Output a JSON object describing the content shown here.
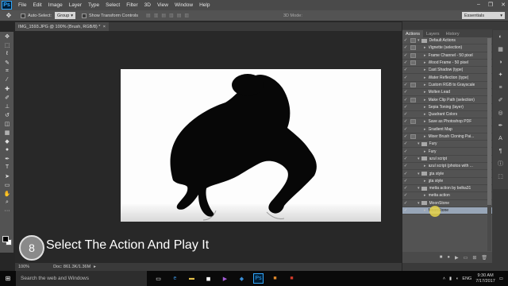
{
  "menubar": {
    "logo": "Ps",
    "items": [
      "File",
      "Edit",
      "Image",
      "Layer",
      "Type",
      "Select",
      "Filter",
      "3D",
      "View",
      "Window",
      "Help"
    ],
    "window_controls": [
      "–",
      "❐",
      "✕"
    ]
  },
  "options": {
    "auto_select_label": "Auto-Select:",
    "auto_select_value": "Group",
    "transform_label": "Show Transform Controls",
    "mode_3d_label": "3D Mode:",
    "workspace": "Essentials"
  },
  "document": {
    "tab_title": "IMG_1593.JPG @ 100% (Brush, RGB/8) *",
    "zoom": "100%",
    "doc_info": "Doc: 861.3K/1.36M"
  },
  "panel_tabs": [
    "Actions",
    "Layers",
    "History"
  ],
  "actions": [
    {
      "label": "Default Actions",
      "kind": "set",
      "dialog": true
    },
    {
      "label": "Vignette (selection)",
      "kind": "action",
      "dialog": true
    },
    {
      "label": "Frame Channel - 50 pixel",
      "kind": "action",
      "dialog": true
    },
    {
      "label": "Wood Frame - 50 pixel",
      "kind": "action",
      "dialog": true
    },
    {
      "label": "Cast Shadow (type)",
      "kind": "action",
      "dialog": false
    },
    {
      "label": "Water Reflection (type)",
      "kind": "action",
      "dialog": false
    },
    {
      "label": "Custom RGB to Grayscale",
      "kind": "action",
      "dialog": true
    },
    {
      "label": "Molten Lead",
      "kind": "action",
      "dialog": false
    },
    {
      "label": "Make Clip Path (selection)",
      "kind": "action",
      "dialog": true
    },
    {
      "label": "Sepia Toning (layer)",
      "kind": "action",
      "dialog": false
    },
    {
      "label": "Quadrant Colors",
      "kind": "action",
      "dialog": false
    },
    {
      "label": "Save as Photoshop PDF",
      "kind": "action",
      "dialog": true
    },
    {
      "label": "Gradient Map",
      "kind": "action",
      "dialog": false
    },
    {
      "label": "Mixer Brush Cloning Pai...",
      "kind": "action",
      "dialog": true
    },
    {
      "label": "Fury",
      "kind": "set",
      "dialog": false
    },
    {
      "label": "Fury",
      "kind": "action",
      "dialog": false
    },
    {
      "label": "azul script",
      "kind": "set",
      "dialog": false
    },
    {
      "label": "azul script (photos with ...",
      "kind": "action",
      "dialog": false
    },
    {
      "label": "gta style",
      "kind": "set",
      "dialog": false
    },
    {
      "label": "gta style",
      "kind": "action",
      "dialog": false
    },
    {
      "label": "metta action by belka31",
      "kind": "set",
      "dialog": false
    },
    {
      "label": "metta action",
      "kind": "action",
      "dialog": false
    },
    {
      "label": "MoonStone",
      "kind": "set",
      "dialog": false
    },
    {
      "label": "MoonStone",
      "kind": "action",
      "dialog": false,
      "selected": true
    }
  ],
  "step": {
    "number": "8",
    "text": "Select The Action And Play It"
  },
  "taskbar": {
    "search_placeholder": "Search the web and Windows",
    "language": "ENG",
    "time": "9:30 AM",
    "date": "7/17/2017"
  }
}
